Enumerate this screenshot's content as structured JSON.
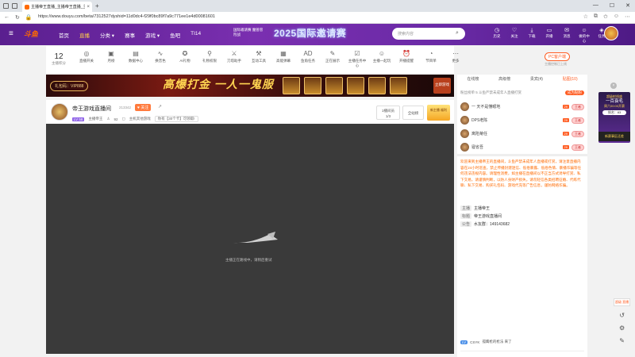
{
  "browser": {
    "tab_title": "主播帝王直播_主播帝王直播_主...",
    "url": "https://www.douyu.com/beta/7312527dyshid=11d0dc4-f29f0bc89f7a9c771ee1e4d00081601",
    "window_controls": [
      "—",
      "☐",
      "✕"
    ]
  },
  "header": {
    "logo": "斗鱼",
    "nav": [
      {
        "label": "首页"
      },
      {
        "label": "直播",
        "active": true
      },
      {
        "label": "分类 ▾"
      },
      {
        "label": "赛事"
      },
      {
        "label": "游戏 ▾"
      },
      {
        "label": "鱼吧"
      },
      {
        "label": "TI14"
      }
    ],
    "event_banner": "2025国际邀请赛",
    "event_sub": "国际邀请赛 魔兽冒险战",
    "search_placeholder": "搜索内容",
    "tools": [
      {
        "icon": "history-icon",
        "glyph": "◷",
        "label": "历史"
      },
      {
        "icon": "heart-icon",
        "glyph": "♡",
        "label": "关注"
      },
      {
        "icon": "download-icon",
        "glyph": "⤓",
        "label": "下载"
      },
      {
        "icon": "broadcast-icon",
        "glyph": "▭",
        "label": "开播"
      },
      {
        "icon": "news-icon",
        "glyph": "✉",
        "label": "消息"
      },
      {
        "icon": "user-center-icon",
        "glyph": "☺",
        "label": "做的中心"
      },
      {
        "icon": "task-icon",
        "glyph": "◈",
        "label": "任务"
      }
    ]
  },
  "toolstrip": {
    "score_value": "12",
    "score_label": "主播积分",
    "tools": [
      {
        "glyph": "◎",
        "label": "直播开关",
        "icon": "live-switch-icon"
      },
      {
        "glyph": "▣",
        "label": "月榜",
        "icon": "monthly-icon"
      },
      {
        "glyph": "▤",
        "label": "数据中心",
        "icon": "data-icon"
      },
      {
        "glyph": "∿",
        "label": "换音色",
        "icon": "voice-icon"
      },
      {
        "glyph": "✪",
        "label": "AI礼物",
        "icon": "ai-gift-icon"
      },
      {
        "glyph": "⚲",
        "label": "礼物权限",
        "icon": "gift-perm-icon"
      },
      {
        "glyph": "⚔",
        "label": "刀塔助手",
        "icon": "dota-icon"
      },
      {
        "glyph": "⚒",
        "label": "互动工具",
        "icon": "interact-icon"
      },
      {
        "glyph": "▦",
        "label": "高能弹幕",
        "icon": "danmaku-icon"
      },
      {
        "glyph": "AD",
        "label": "鱼角任务",
        "icon": "ad-icon"
      },
      {
        "glyph": "✎",
        "label": "正在展示",
        "icon": "showing-icon"
      },
      {
        "glyph": "☑",
        "label": "主播任务中心",
        "icon": "task-center-icon"
      },
      {
        "glyph": "☺",
        "label": "主播一起玩",
        "icon": "play-together-icon"
      },
      {
        "glyph": "⏰",
        "label": "开播提醒",
        "icon": "reminder-icon"
      },
      {
        "glyph": "◔",
        "label": "节目单",
        "icon": "schedule-icon"
      },
      {
        "glyph": "⋯",
        "label": "更多",
        "icon": "more-icon"
      }
    ],
    "pc_client": "PC客户端",
    "pc_client_sub": "主播控制已上线"
  },
  "ad": {
    "gift_code": "礼包码：VIP888",
    "slogan": "高爆打金 一人一鬼服",
    "button": "立即游戏"
  },
  "room": {
    "title": "帝王游戏直播间",
    "room_id": "213342",
    "follow": "♥ 关注",
    "level": "LV 58",
    "host": "主播帝王",
    "fans": "92",
    "category": "主机其他游戏",
    "tip": "你有【30个卡】可领取!",
    "page_label": "1播间员",
    "page_value": "1/3",
    "all_rank": "全站榜",
    "rank_ad": "新主播 福利"
  },
  "player": {
    "offline_text": "主播正在路线中，请稍后重试"
  },
  "right_panel": {
    "tabs": [
      {
        "label": "在线榜"
      },
      {
        "label": "高级榜"
      },
      {
        "label": "贵宾(4)"
      },
      {
        "label": "贴图(10)",
        "active": true
      }
    ],
    "sub_text": "粉丝榜单 5  斗鱼严禁未成年人直播打赏",
    "sub_tag": "成为贴粉",
    "fans": [
      {
        "name": "一 天不是懂眼地",
        "level": "29",
        "badge": "王者"
      },
      {
        "name": "DPS老陈",
        "level": "29",
        "badge": "王者"
      },
      {
        "name": "离陷菊任",
        "level": "29",
        "badge": "王者"
      },
      {
        "name": "寝省吾",
        "level": "29",
        "badge": "王者"
      }
    ],
    "notice": "欢迎来到主播帝王的直播间，斗鱼严禁未成年人直播或打赏，请注意直播内容在24小时巡查，禁止传播封建迷信、低俗暴露、低俗色情、暴播诈骗等任何违法违规内容。请理性消费，如主播在直播间以不正当方式诱导打赏、私下交易，请谨慎判断，以防人身财产损失。请勿轻信各类招聘征婚、代练代聊、私下交易、购买礼包码、游戏代充等广告信息，谨防网络诈骗。",
    "info": [
      {
        "label": "主播",
        "value": "主播帝王"
      },
      {
        "label": "标题",
        "value": "帝王游戏直播间"
      },
      {
        "label": "公告",
        "value": "水友群：149143682"
      }
    ],
    "chat_user_level": "LV",
    "chat_name": "CSYK",
    "chat_text": "孤鹰枪的枪法  来了"
  },
  "side": {
    "promo_top": "超级射线盛",
    "promo_title": "一百衰毛",
    "promo_sub": "周六00:00开赛",
    "promo_btn": "排名：83",
    "promo_bottom": "新赛事区还差",
    "close": "×",
    "float_badge": "超级 直播"
  }
}
